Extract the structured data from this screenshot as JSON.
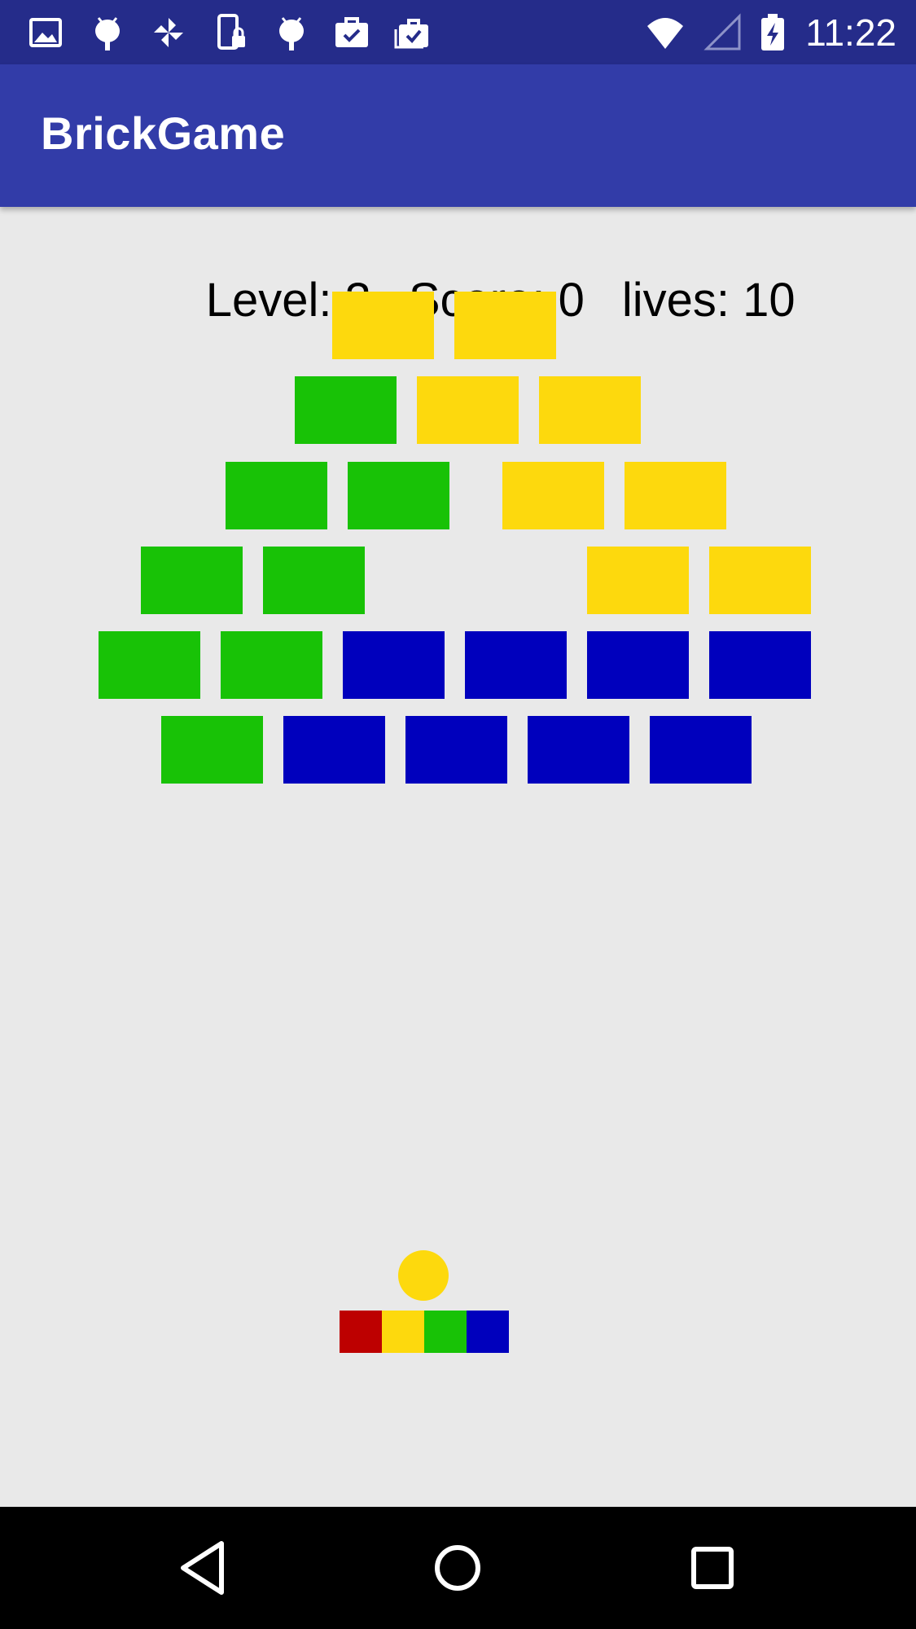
{
  "status_bar": {
    "time": "11:22",
    "icons_left": [
      "image-icon",
      "android-debug-icon",
      "pinwheel-icon",
      "phone-lock-icon",
      "android-debug-icon",
      "briefcase-check-icon",
      "briefcases-check-icon"
    ],
    "icons_right": [
      "wifi-icon",
      "cell-signal-icon",
      "battery-charging-icon"
    ]
  },
  "app_bar": {
    "title": "BrickGame"
  },
  "hud": {
    "level_text": "Level: 3",
    "score_text": "Score: 0",
    "lives_text": "lives: 10"
  },
  "game": {
    "colors": {
      "yellow": "#fdd90d",
      "green": "#18c206",
      "blue": "#0000bd",
      "red": "#bd0000"
    },
    "bricks": [
      [
        "yellow",
        "yellow"
      ],
      [
        "green",
        "yellow",
        "yellow"
      ],
      [
        "green",
        "green",
        "yellow",
        "yellow"
      ],
      [
        "green",
        "green",
        "yellow",
        "yellow"
      ],
      [
        "green",
        "green",
        "blue",
        "blue",
        "blue",
        "blue"
      ],
      [
        "green",
        "blue",
        "blue",
        "blue",
        "blue"
      ]
    ],
    "ball_color": "yellow",
    "paddle_segments": [
      "red",
      "yellow",
      "green",
      "blue"
    ]
  },
  "nav_bar": {
    "buttons": [
      "back-icon",
      "home-icon",
      "recents-icon"
    ]
  }
}
